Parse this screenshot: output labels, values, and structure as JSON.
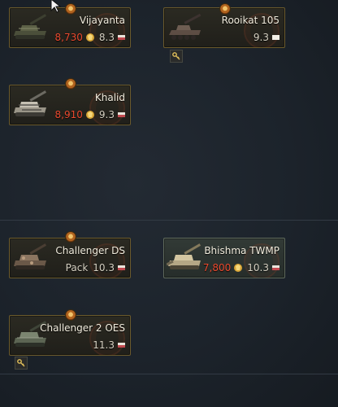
{
  "vehicles": [
    {
      "name": "Vijayanta",
      "price": "8,730",
      "br": "8.3",
      "pack": ""
    },
    {
      "name": "Rooikat 105",
      "price": "",
      "br": "9.3",
      "pack": ""
    },
    {
      "name": "Khalid",
      "price": "8,910",
      "br": "9.3",
      "pack": ""
    },
    {
      "name": "Challenger DS",
      "price": "",
      "br": "10.3",
      "pack": "Pack"
    },
    {
      "name": "Bhishma TWMP",
      "price": "7,800",
      "br": "10.3",
      "pack": ""
    },
    {
      "name": "Challenger 2 OES",
      "price": "",
      "br": "11.3",
      "pack": ""
    }
  ],
  "colors": {
    "background": "#1c232b",
    "card_border": "#6b5a2c",
    "price_red": "#ea4a2f",
    "name_text": "#f1ecdd",
    "researched_card": "#323a36"
  },
  "icons": {
    "currency": "golden-lions-icon",
    "flag": "country-flag-icon",
    "rank": "rank-medal-icon",
    "key": "key-icon",
    "cursor": "mouse-cursor-icon"
  }
}
